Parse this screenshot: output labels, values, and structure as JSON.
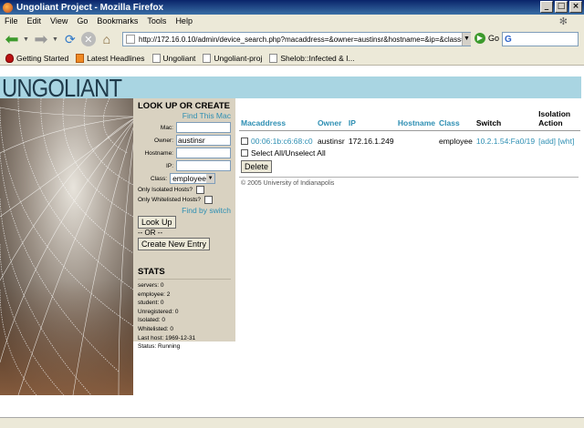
{
  "window": {
    "title": "Ungoliant Project - Mozilla Firefox",
    "buttons": [
      "_",
      "□",
      "×"
    ]
  },
  "menu": [
    "File",
    "Edit",
    "View",
    "Go",
    "Bookmarks",
    "Tools",
    "Help"
  ],
  "address": {
    "url": "http://172.16.0.10/admin/device_search.php?macaddress=&owner=austinsr&hostname=&ip=&class=employee&",
    "go_label": "Go"
  },
  "bookmarks": [
    "Getting Started",
    "Latest Headlines",
    "Ungoliant",
    "Ungoliant-proj",
    "Shelob::Infected & I..."
  ],
  "brand": "UNGOLIANT",
  "sidebar": {
    "title": "LOOK UP OR CREATE",
    "find_mac_link": "Find This Mac",
    "fields": {
      "mac_label": "Mac:",
      "mac_value": "",
      "owner_label": "Owner:",
      "owner_value": "austinsr",
      "hostname_label": "Hostname:",
      "hostname_value": "",
      "ip_label": "IP:",
      "ip_value": "",
      "class_label": "Class:",
      "class_value": "employee"
    },
    "only_isolated_label": "Only Isolated Hosts?",
    "only_whitelisted_label": "Only Whitelisted Hosts?",
    "find_switch_link": "Find by switch",
    "lookup_button": "Look Up",
    "or_text": "-- OR --",
    "create_button": "Create New Entry",
    "stats": {
      "title": "STATS",
      "lines": [
        "servers: 0",
        "employee: 2",
        "student: 0",
        "Unregistered: 0",
        "Isolated: 0",
        "Whitelisted: 0",
        "Last host: 1969-12-31",
        "Status: Running"
      ]
    }
  },
  "results": {
    "headers": {
      "mac": "Macaddress",
      "owner": "Owner",
      "ip": "IP",
      "hostname": "Hostname",
      "class": "Class",
      "switch": "Switch",
      "isolation": "Isolation Action"
    },
    "rows": [
      {
        "mac": "00:06:1b:c6:68:c0",
        "owner": "austinsr",
        "ip": "172.16.1.249",
        "hostname": "",
        "class": "employee",
        "switch": "10.2.1.54:Fa0/19",
        "add": "[add]",
        "wht": "[wht]"
      }
    ],
    "select_all_label": "Select All/Unselect All",
    "delete_button": "Delete",
    "copyright": "© 2005 University of Indianapolis"
  }
}
